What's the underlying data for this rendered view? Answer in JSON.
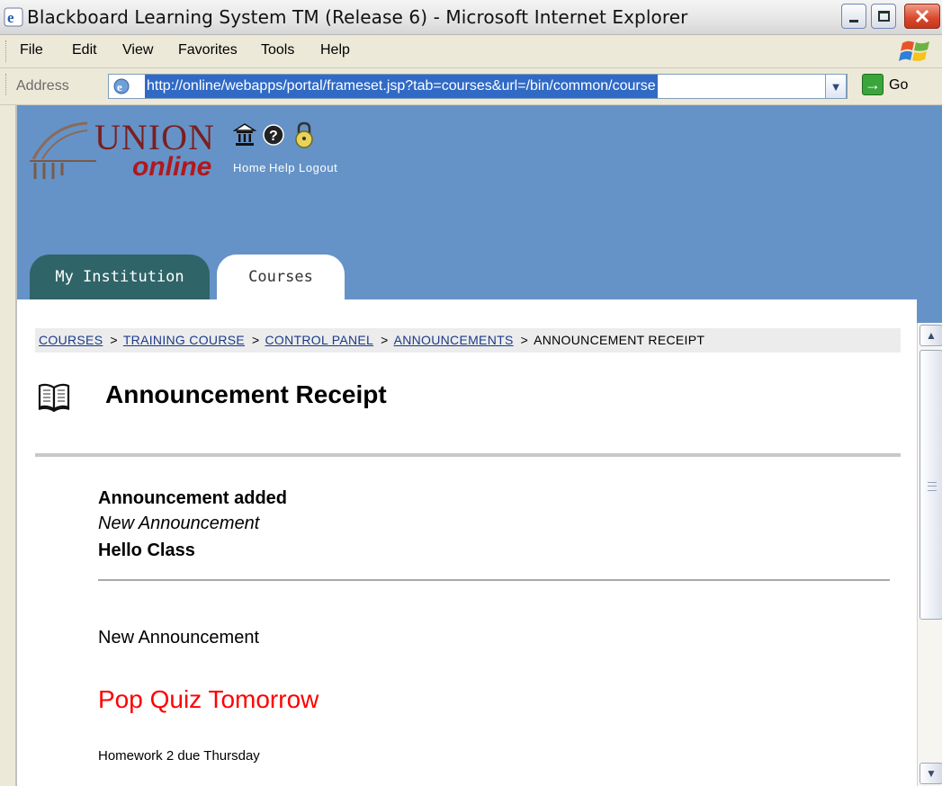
{
  "window": {
    "title": "Blackboard Learning System TM (Release 6) - Microsoft Internet Explorer"
  },
  "menu": {
    "items": [
      "File",
      "Edit",
      "View",
      "Favorites",
      "Tools",
      "Help"
    ]
  },
  "address_bar": {
    "label": "Address",
    "url": "http://online/webapps/portal/frameset.jsp?tab=courses&url=/bin/common/course",
    "go_label": "Go"
  },
  "header": {
    "logo_union": "UNION",
    "logo_online": "online",
    "nav": [
      {
        "label": "Home",
        "icon": "home-icon"
      },
      {
        "label": "Help",
        "icon": "help-icon"
      },
      {
        "label": "Logout",
        "icon": "lock-icon"
      }
    ]
  },
  "tabs": [
    {
      "label": "My Institution",
      "active": false
    },
    {
      "label": "Courses",
      "active": true
    }
  ],
  "breadcrumb": {
    "links": [
      "COURSES",
      "TRAINING COURSE",
      "CONTROL PANEL",
      "ANNOUNCEMENTS"
    ],
    "current": "ANNOUNCEMENT RECEIPT",
    "separator": ">"
  },
  "page": {
    "title": "Announcement Receipt",
    "title_icon": "book-icon"
  },
  "receipt": {
    "status": "Announcement added",
    "type": "New Announcement",
    "subject": "Hello Class"
  },
  "announcement": {
    "heading": "New Announcement",
    "highlight": "Pop Quiz Tomorrow",
    "note": "Homework 2 due Thursday"
  },
  "colors": {
    "header_bg": "#6593c7",
    "inactive_tab": "#2f6468",
    "highlight_text": "#ff0000",
    "link": "#1a3a8a"
  }
}
